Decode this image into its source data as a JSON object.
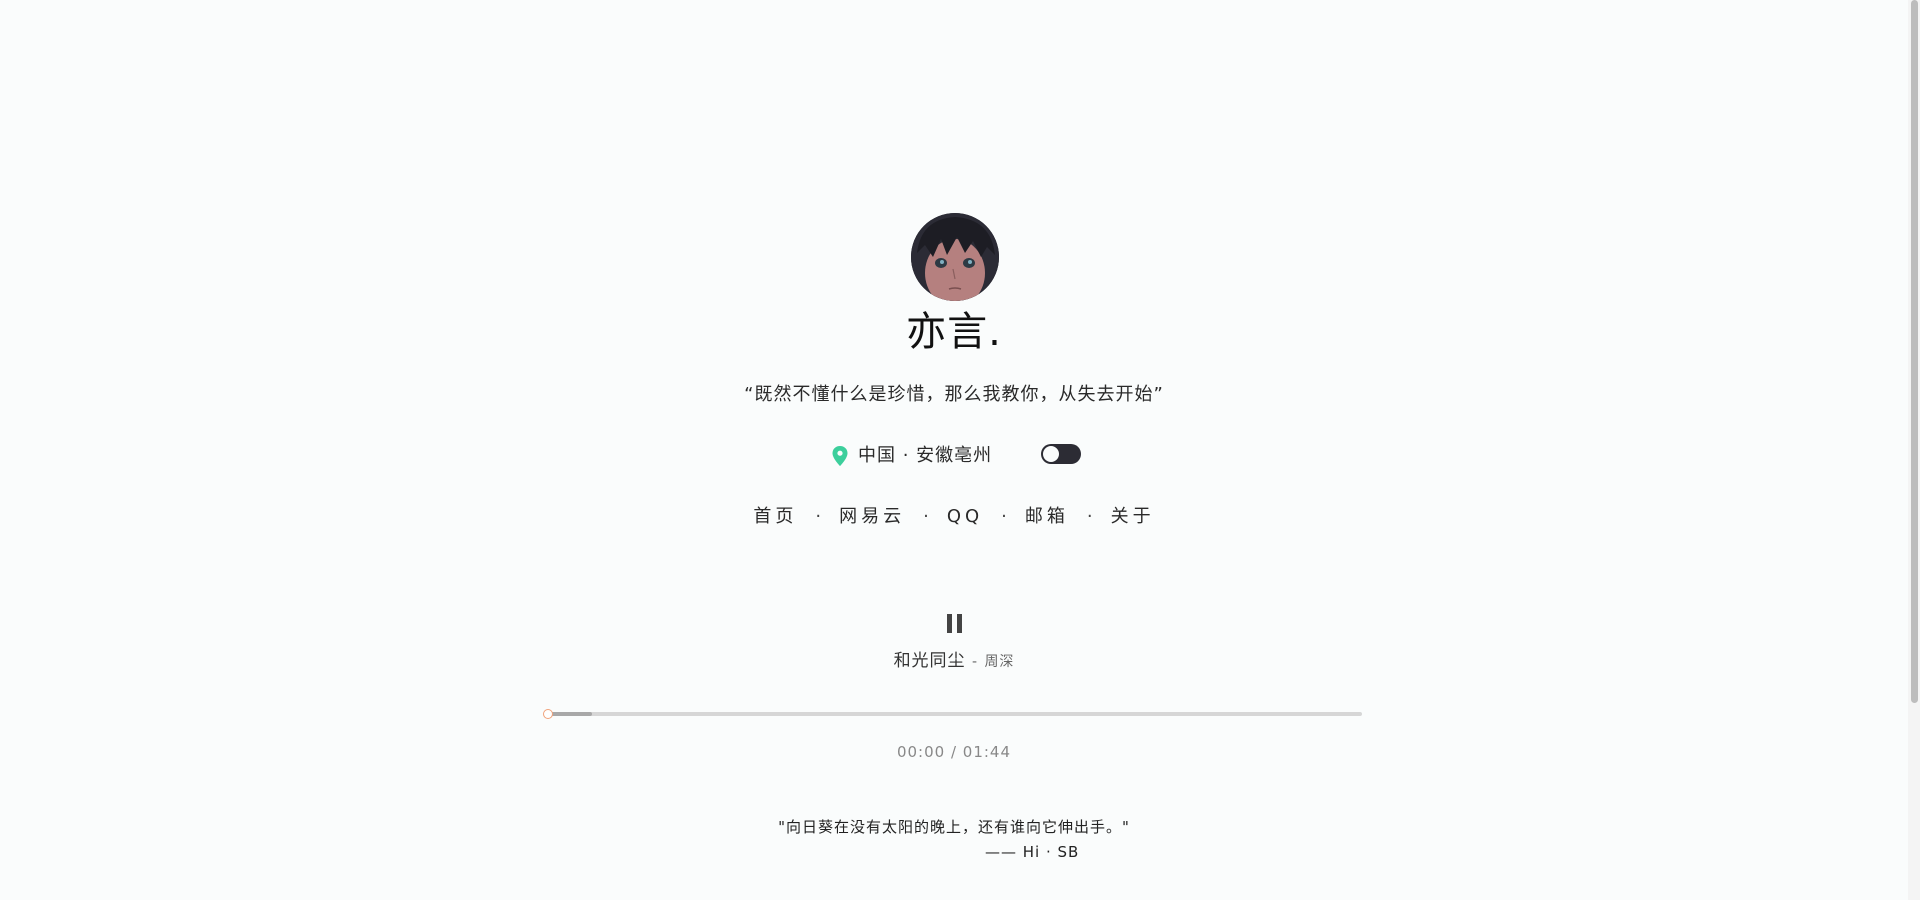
{
  "profile": {
    "name": "亦言.",
    "motto": "“既然不懂什么是珍惜，那么我教你，从失去开始”",
    "location": "中国 · 安徽亳州",
    "avatar_icon": "anime-avatar"
  },
  "nav": {
    "items": [
      {
        "label": "首页"
      },
      {
        "label": "网易云"
      },
      {
        "label": "QQ"
      },
      {
        "label": "邮箱"
      },
      {
        "label": "关于"
      }
    ],
    "separator": "·"
  },
  "player": {
    "state": "playing",
    "song_title": "和光同尘",
    "separator": "-",
    "artist": "周深",
    "time_text": "00:00 / 01:44",
    "played_fraction": 0.0,
    "buffered_fraction": 0.055
  },
  "quote": {
    "text": "\"向日葵在没有太阳的晚上，还有谁向它伸出手。\"",
    "author": "—— Hi · SB"
  },
  "colors": {
    "background": "#fafcfc",
    "pin": "#3ccf9c",
    "toggle": "#2c2c34",
    "progress_dot": "#f0a27a"
  }
}
